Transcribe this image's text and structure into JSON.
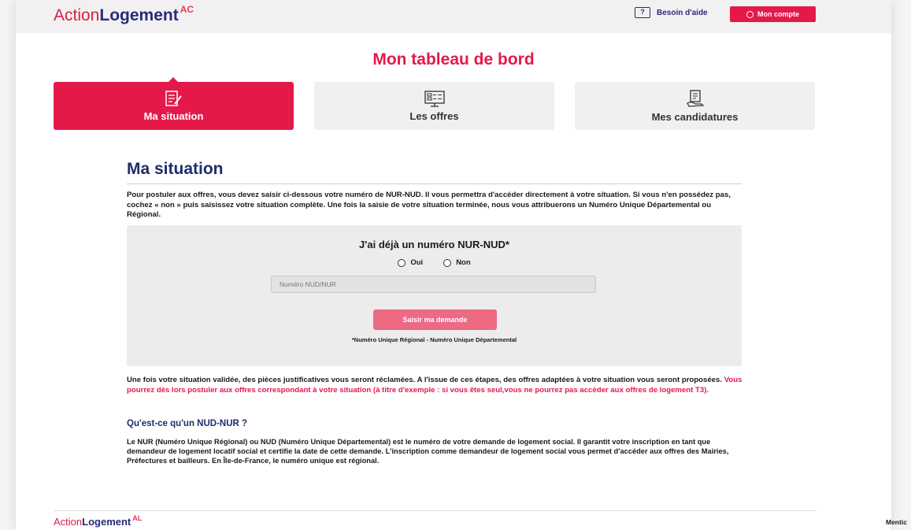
{
  "header": {
    "logo_part1": "Action",
    "logo_part2": "Logement",
    "logo_badge": "AC",
    "help_icon_text": "?",
    "help_label": "Besoin d'aide",
    "account_label": "Mon compte"
  },
  "page": {
    "title": "Mon tableau de bord"
  },
  "tabs": [
    {
      "label": "Ma situation",
      "icon": "document-edit-icon",
      "active": true
    },
    {
      "label": "Les offres",
      "icon": "grid-list-icon",
      "active": false
    },
    {
      "label": "Mes candidatures",
      "icon": "hand-document-icon",
      "active": false
    }
  ],
  "section": {
    "title": "Ma situation",
    "intro": "Pour postuler aux offres, vous devez saisir ci-dessous votre numéro de NUR-NUD. Il vous permettra d'accéder directement à votre situation. Si vous n'en possédez pas, cochez « non » puis saisissez votre situation complète. Une fois la saisie de votre situation terminée, nous vous attribuerons un Numéro Unique Départemental ou Régional."
  },
  "form": {
    "question": "J'ai déjà un numéro NUR-NUD*",
    "option_yes": "Oui",
    "option_no": "Non",
    "input_placeholder": "Numéro NUD/NUR",
    "submit_label": "Saisir ma demande",
    "footnote": "*Numéro Unique Régional - Numéro Unique Départemental"
  },
  "after": {
    "text": "Une fois votre situation validée, des pièces justificatives vous seront réclamées. A l'issue de ces étapes, des offres adaptées à votre situation vous seront proposées. ",
    "highlight": "Vous pourrez dès lors postuler aux offres correspondant à votre situation (à titre d'exemple : si vous êtes seul,vous ne pourrez pas accéder aux offres de logement T3)."
  },
  "faq": {
    "title": "Qu'est-ce qu'un NUD-NUR ?",
    "body": "Le NUR (Numéro Unique Régional) ou NUD (Numéro Unique Départemental) est le numéro de votre demande de logement social. Il garantit votre inscription en tant que demandeur de logement locatif social et certifie la date de cette demande. L'inscription comme demandeur de logement social vous permet d'accéder aux offres des Mairies, Préfectures et bailleurs. En Île-de-France, le numéro unique est régional."
  },
  "footer": {
    "logo_part1": "Action",
    "logo_part2": "Logement",
    "logo_badge": "AL",
    "mentions": "Mentic"
  },
  "colors": {
    "brand_red": "#e4194a",
    "navy": "#1f2c6b"
  }
}
